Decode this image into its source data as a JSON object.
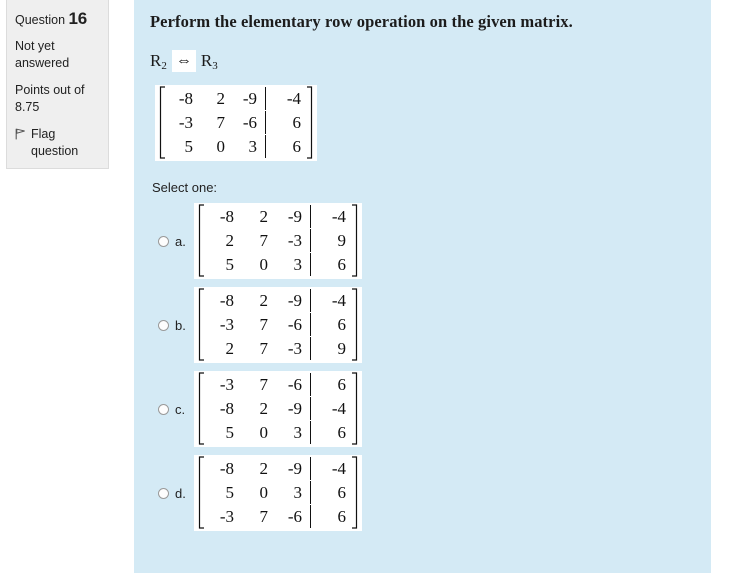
{
  "sidebar": {
    "question_label": "Question",
    "question_number": "16",
    "status": "Not yet answered",
    "points_label": "Points out of",
    "points_value": "8.75",
    "flag_icon": "flag-icon",
    "flag_label": "Flag question"
  },
  "main": {
    "prompt": "Perform the elementary row operation on the given matrix.",
    "operation": {
      "left_row": "R",
      "left_sub": "2",
      "arrow": "⇔",
      "right_row": "R",
      "right_sub": "3"
    },
    "given_matrix": {
      "rows": [
        [
          "-8",
          "2",
          "-9",
          "-4"
        ],
        [
          "-3",
          "7",
          "-6",
          "6"
        ],
        [
          "5",
          "0",
          "3",
          "6"
        ]
      ],
      "augmented_column": 3
    },
    "select_label": "Select one:",
    "options": [
      {
        "letter": "a.",
        "selected": false,
        "rows": [
          [
            "-8",
            "2",
            "-9",
            "-4"
          ],
          [
            "2",
            "7",
            "-3",
            "9"
          ],
          [
            "5",
            "0",
            "3",
            "6"
          ]
        ]
      },
      {
        "letter": "b.",
        "selected": false,
        "rows": [
          [
            "-8",
            "2",
            "-9",
            "-4"
          ],
          [
            "-3",
            "7",
            "-6",
            "6"
          ],
          [
            "2",
            "7",
            "-3",
            "9"
          ]
        ]
      },
      {
        "letter": "c.",
        "selected": false,
        "rows": [
          [
            "-3",
            "7",
            "-6",
            "6"
          ],
          [
            "-8",
            "2",
            "-9",
            "-4"
          ],
          [
            "5",
            "0",
            "3",
            "6"
          ]
        ]
      },
      {
        "letter": "d.",
        "selected": false,
        "rows": [
          [
            "-8",
            "2",
            "-9",
            "-4"
          ],
          [
            "5",
            "0",
            "3",
            "6"
          ],
          [
            "-3",
            "7",
            "-6",
            "6"
          ]
        ]
      }
    ]
  },
  "colors": {
    "panel_background": "#d4eaf5",
    "sidebar_background": "#efefef",
    "sidebar_border": "#dcdcdc",
    "matrix_background": "#ffffff",
    "text": "#222222"
  }
}
